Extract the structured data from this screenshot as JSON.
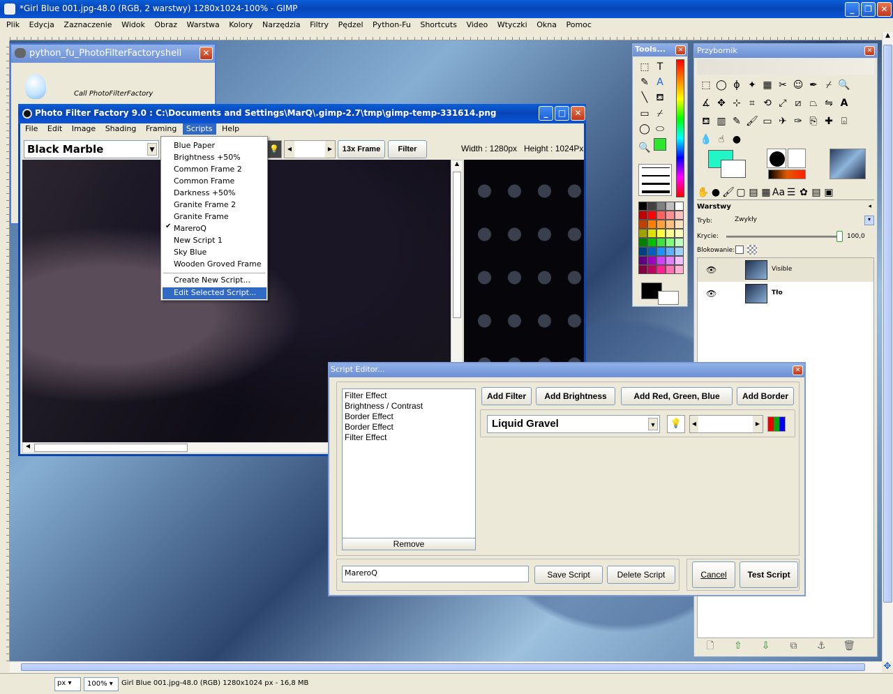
{
  "gimp": {
    "title": "*Girl Blue 001.jpg-48.0 (RGB, 2 warstwy) 1280x1024-100% - GIMP",
    "menu": [
      "Plik",
      "Edycja",
      "Zaznaczenie",
      "Widok",
      "Obraz",
      "Warstwa",
      "Kolory",
      "Narzędzia",
      "Filtry",
      "Pędzel",
      "Python-Fu",
      "Shortcuts",
      "Video",
      "Wtyczki",
      "Okna",
      "Pomoc"
    ],
    "unit": "px",
    "zoom": "100%",
    "status": "Girl Blue 001.jpg-48.0 (RGB) 1280x1024 px - 16,8 MB"
  },
  "shell": {
    "title": "python_fu_PhotoFilterFactoryshell",
    "call_label": "Call PhotoFilterFactory"
  },
  "pff": {
    "title": "Photo Filter Factory 9.0 : C:\\Documents and Settings\\MarQ\\.gimp-2.7\\tmp\\gimp-temp-331614.png",
    "menu": [
      "File",
      "Edit",
      "Image",
      "Shading",
      "Framing",
      "Scripts",
      "Help"
    ],
    "combo_value": "Black Marble",
    "frame_button": "13x Frame",
    "filter_button": "Filter",
    "width_label": "Width : 1280px",
    "height_label": "Height : 1024Px",
    "scripts_menu": [
      "Blue Paper",
      "Brightness +50%",
      "Common Frame 2",
      "Common Frame",
      "Darkness +50%",
      "Granite Frame 2",
      "Granite Frame",
      "MareroQ",
      "New Script 1",
      "Sky Blue",
      "Wooden Groved Frame"
    ],
    "checked_item": "MareroQ",
    "scripts_menu_actions": [
      "Create New Script...",
      "Edit Selected Script..."
    ]
  },
  "tools": {
    "title": "Tools..."
  },
  "toolbox": {
    "title": "Przybornik",
    "layers_title": "Warstwy",
    "mode_label": "Tryb:",
    "mode_value": "Zwykły",
    "opacity_label": "Krycie:",
    "opacity_value": "100,0",
    "lock_label": "Blokowanie:",
    "layers": [
      "Visible",
      "Tło"
    ]
  },
  "editor": {
    "title": "Script Editor...",
    "steps": [
      "Filter Effect",
      "Brightness / Contrast",
      "Border Effect",
      "Border Effect",
      "Filter Effect"
    ],
    "remove": "Remove",
    "add_filter": "Add Filter",
    "add_brightness": "Add Brightness",
    "add_rgb": "Add Red, Green, Blue",
    "add_border": "Add Border",
    "combo_value": "Liquid Gravel",
    "name_value": "MareroQ",
    "save": "Save Script",
    "delete": "Delete Script",
    "cancel": "Cancel",
    "test": "Test Script"
  },
  "colors": {
    "xp_blue": "#0a5fd8",
    "fg_color": "#22f5c6",
    "bg_color": "#ffffff",
    "swatches": [
      "#000000",
      "#404040",
      "#808080",
      "#c0c0c0",
      "#ffffff",
      "#c00000",
      "#ff0000",
      "#ff6060",
      "#ff9090",
      "#ffc0c0",
      "#c04000",
      "#ff8000",
      "#ffa040",
      "#ffc080",
      "#ffe0c0",
      "#a0a000",
      "#e0e000",
      "#ffff40",
      "#ffff90",
      "#ffffc0",
      "#008000",
      "#00c000",
      "#40e040",
      "#80ff80",
      "#c0ffc0",
      "#004080",
      "#0060c0",
      "#2090ff",
      "#60b0ff",
      "#a0d0ff",
      "#600080",
      "#a000c0",
      "#d040ff",
      "#e080ff",
      "#f0c0ff",
      "#800040",
      "#c00060",
      "#ff2090",
      "#ff70b0",
      "#ffb0d0"
    ]
  }
}
